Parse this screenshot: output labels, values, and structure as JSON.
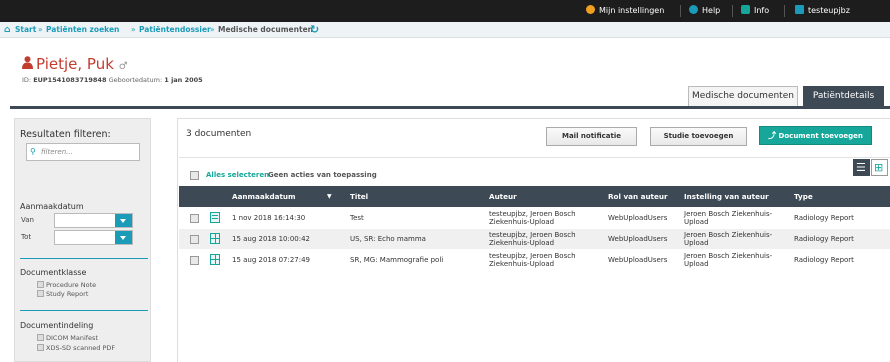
{
  "topbar": {
    "settings": "Mijn instellingen",
    "help": "Help",
    "info": "Info",
    "logout": "testeupjbz afmelden"
  },
  "breadcrumb": {
    "items": [
      "Start",
      "Patiënten zoeken",
      "Patiëntendossier",
      "Medische documenten"
    ],
    "separator": "»"
  },
  "patient": {
    "name": "Pietje, Puk",
    "id_label": "ID:",
    "id": "EUP1541083719848",
    "dob_label": "Geboortedatum:",
    "dob": "1 jan 2005"
  },
  "tabs": {
    "documents": "Medische documenten",
    "details": "Patiëntdetails"
  },
  "filter": {
    "title": "Resultaten filteren:",
    "search_placeholder": "filteren...",
    "creation_date": "Aanmaakdatum",
    "from": "Van",
    "to": "Tot",
    "doc_class": "Documentklasse",
    "doc_class_options": [
      "Procedure Note",
      "Study Report"
    ],
    "doc_format": "Documentindeling",
    "doc_format_options": [
      "DICOM Manifest",
      "XDS-SD scanned PDF"
    ]
  },
  "main": {
    "count": "3 documenten",
    "mail_button": "Mail notificatie",
    "study_button": "Studie toevoegen",
    "add_button": "Document toevoegen",
    "select_all": "Alles selecteren",
    "no_actions": "Geen acties van toepassing"
  },
  "table": {
    "headers": [
      "Aanmaakdatum",
      "Titel",
      "Auteur",
      "Rol van auteur",
      "Instelling van auteur",
      "Type"
    ],
    "rows": [
      {
        "date": "1 nov 2018 16:14:30",
        "title": "Test",
        "author1": "testeupjbz, Jeroen Bosch",
        "author2": "Ziekenhuis-Upload",
        "role": "WebUploadUsers",
        "inst1": "Jeroen Bosch Ziekenhuis-",
        "inst2": "Upload",
        "type": "Radiology Report"
      },
      {
        "date": "15 aug 2018 10:00:42",
        "title": "US, SR: Echo mamma",
        "author1": "testeupjbz, Jeroen Bosch",
        "author2": "Ziekenhuis-Upload",
        "role": "WebUploadUsers",
        "inst1": "Jeroen Bosch Ziekenhuis-",
        "inst2": "Upload",
        "type": "Radiology Report"
      },
      {
        "date": "15 aug 2018 07:27:49",
        "title": "SR, MG: Mammografie poli",
        "author1": "testeupjbz, Jeroen Bosch",
        "author2": "Ziekenhuis-Upload",
        "role": "WebUploadUsers",
        "inst1": "Jeroen Bosch Ziekenhuis-",
        "inst2": "Upload",
        "type": "Radiology Report"
      }
    ]
  },
  "colors": {
    "accent": "#1a9bb8",
    "primary_button": "#17a79a",
    "header_dark": "#3d4a55",
    "patient_name": "#c33d2f"
  }
}
